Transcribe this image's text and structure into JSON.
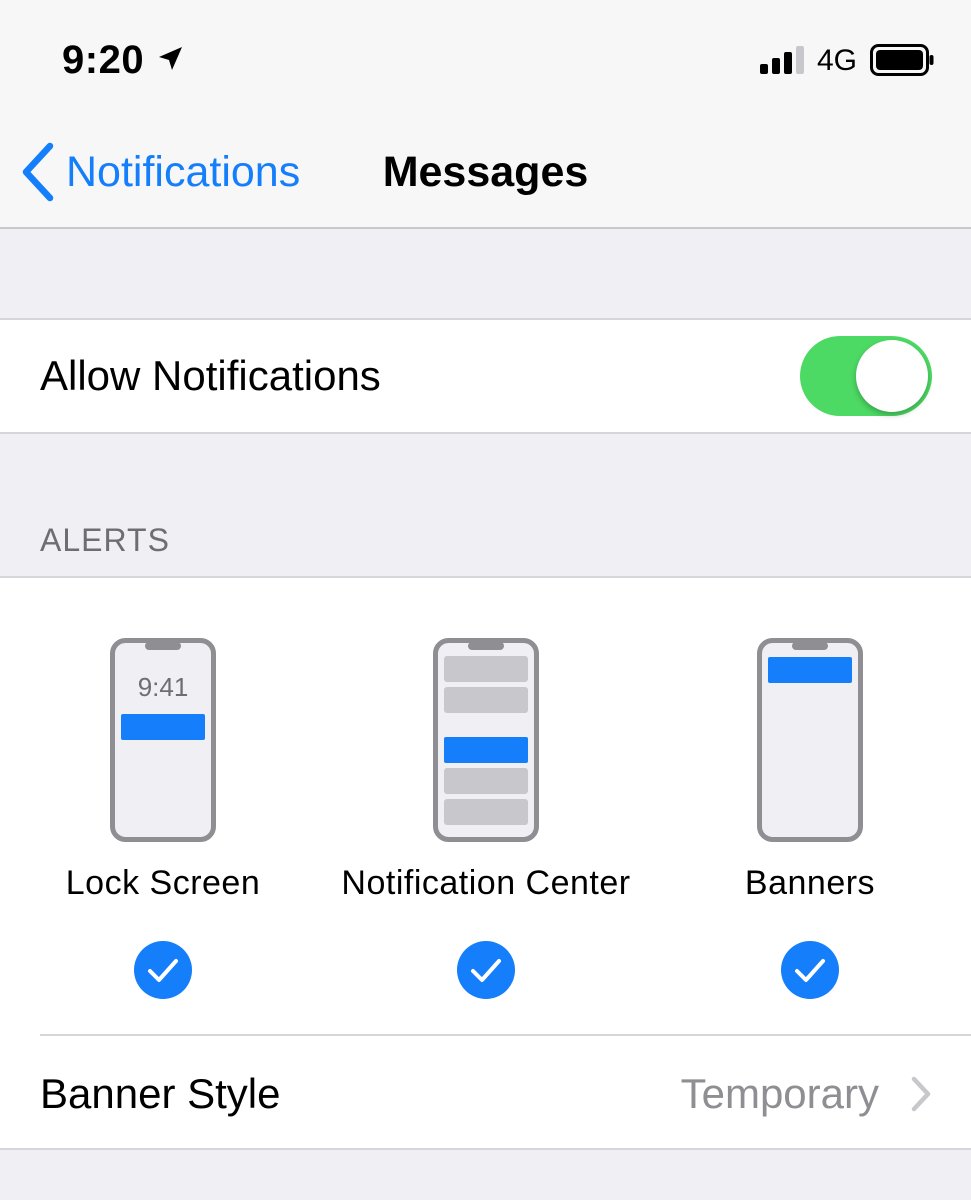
{
  "status_bar": {
    "time": "9:20",
    "network": "4G",
    "location_icon": "location-arrow-icon",
    "signal_icon": "cellular-signal-icon",
    "battery_icon": "battery-icon",
    "signal_bars_active": 3,
    "signal_bars_total": 4,
    "battery_level": 1.0
  },
  "nav": {
    "back_label": "Notifications",
    "title": "Messages",
    "back_icon": "chevron-left-icon"
  },
  "allow_notifications": {
    "label": "Allow Notifications",
    "enabled": true
  },
  "alerts": {
    "header": "ALERTS",
    "options": [
      {
        "label": "Lock Screen",
        "phone_time": "9:41",
        "checked": true
      },
      {
        "label": "Notification Center",
        "checked": true
      },
      {
        "label": "Banners",
        "checked": true
      }
    ]
  },
  "banner_style": {
    "label": "Banner Style",
    "value": "Temporary",
    "icon": "chevron-right-icon"
  },
  "colors": {
    "accent": "#157efb",
    "toggle_on": "#4cd964",
    "check": "#157efb",
    "secondary_text": "#8e8e93",
    "background": "#efeff4"
  }
}
